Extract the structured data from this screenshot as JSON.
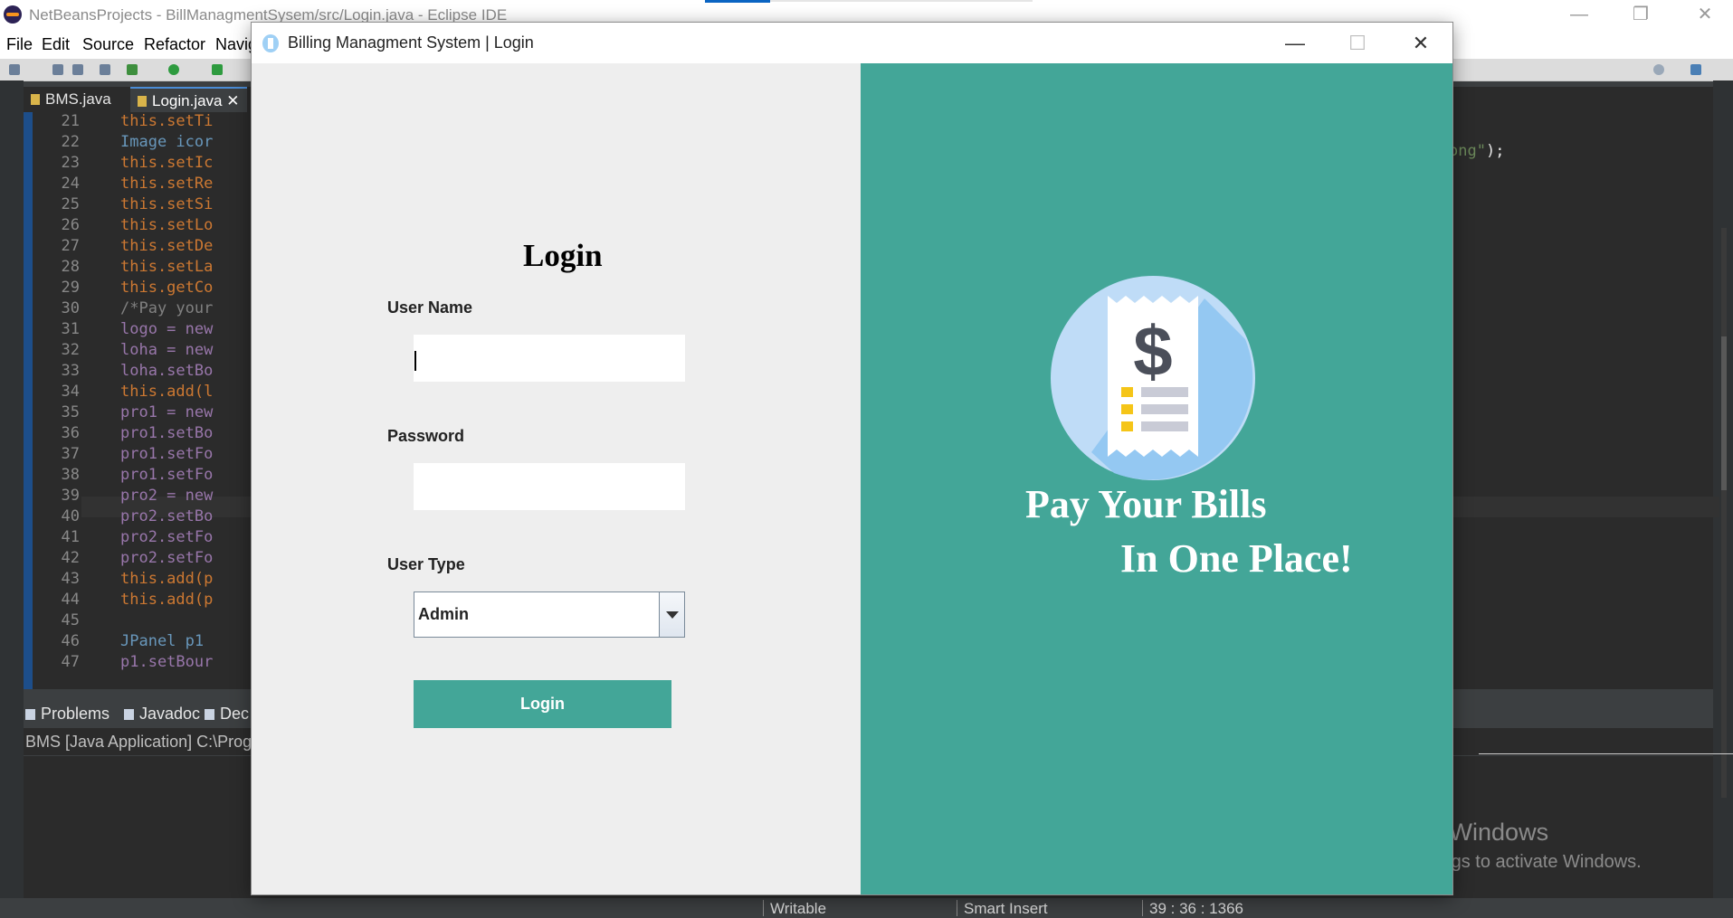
{
  "eclipse": {
    "window_title": "NetBeansProjects - BillManagmentSysem/src/Login.java - Eclipse IDE",
    "menu": [
      "File",
      "Edit",
      "Source",
      "Refactor",
      "Navig"
    ],
    "editor_tabs": [
      "BMS.java",
      "Login.java"
    ],
    "tab_close": "✕",
    "code_lines": [
      {
        "n": "21",
        "code": "this.setTi"
      },
      {
        "n": "22",
        "code": "Image icor"
      },
      {
        "n": "23",
        "code": "this.setIc"
      },
      {
        "n": "24",
        "code": "this.setRe"
      },
      {
        "n": "25",
        "code": "this.setSi"
      },
      {
        "n": "26",
        "code": "this.setLo"
      },
      {
        "n": "27",
        "code": "this.setDe"
      },
      {
        "n": "28",
        "code": "this.setLa"
      },
      {
        "n": "29",
        "code": "this.getCo"
      },
      {
        "n": "30",
        "code": "/*Pay your"
      },
      {
        "n": "31",
        "code": "logo = new"
      },
      {
        "n": "32",
        "code": "loha = new"
      },
      {
        "n": "33",
        "code": "loha.setBo"
      },
      {
        "n": "34",
        "code": "this.add(l"
      },
      {
        "n": "35",
        "code": "pro1 = new"
      },
      {
        "n": "36",
        "code": "pro1.setBo"
      },
      {
        "n": "37",
        "code": "pro1.setFo"
      },
      {
        "n": "38",
        "code": "pro1.setFo"
      },
      {
        "n": "39",
        "code": "pro2 = new"
      },
      {
        "n": "40",
        "code": "pro2.setBo"
      },
      {
        "n": "41",
        "code": "pro2.setFo"
      },
      {
        "n": "42",
        "code": "pro2.setFo"
      },
      {
        "n": "43",
        "code": "this.add(p"
      },
      {
        "n": "44",
        "code": "this.add(p"
      },
      {
        "n": "45",
        "code": ""
      },
      {
        "n": "46",
        "code": "JPanel p1"
      },
      {
        "n": "47",
        "code": "p1.setBour"
      }
    ],
    "right_code_str": "ong\"",
    "right_code_tail": ");",
    "bottom_tabs": [
      "Problems",
      "Javadoc",
      "Dec"
    ],
    "console_header": "BMS [Java Application] C:\\Progr",
    "status": {
      "writable": "Writable",
      "insert": "Smart Insert",
      "position": "39 : 36 : 1366"
    },
    "activate_title": "Activate Windows",
    "activate_sub": "Go to Settings to activate Windows."
  },
  "dialog": {
    "title": "Billing Managment System | Login",
    "controls": {
      "minimize": "—",
      "maximize": "☐",
      "close": "✕"
    },
    "heading": "Login",
    "username_label": "User Name",
    "username_value": "",
    "password_label": "Password",
    "password_value": "",
    "usertype_label": "User Type",
    "usertype_value": "Admin",
    "login_button": "Login",
    "tagline_1": "Pay Your Bills",
    "tagline_2": "In One Place!",
    "colors": {
      "accent": "#43a698",
      "panel": "#eeeeee"
    }
  }
}
